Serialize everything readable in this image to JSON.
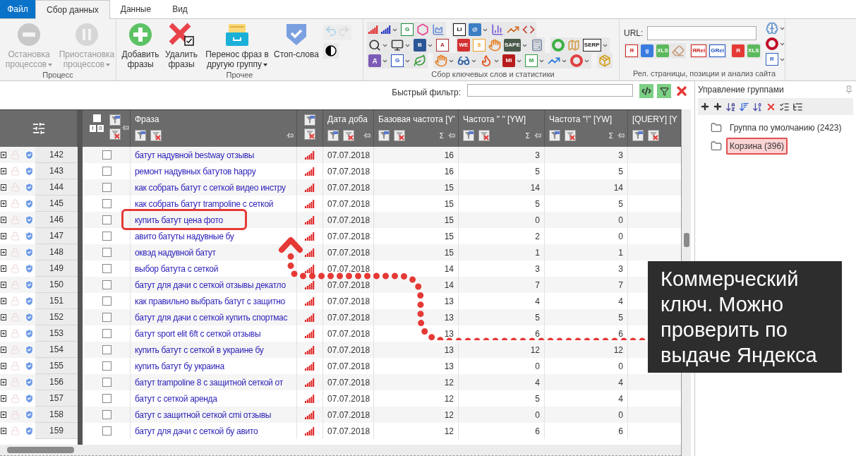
{
  "tabs": [
    {
      "label": "Файл",
      "kind": "file",
      "selected": false
    },
    {
      "label": "Сбор данных",
      "kind": "tab",
      "selected": true
    },
    {
      "label": "Данные",
      "kind": "tab",
      "selected": false
    },
    {
      "label": "Вид",
      "kind": "tab",
      "selected": false
    }
  ],
  "ribbon": {
    "process": {
      "label": "Процесс",
      "buttons": [
        {
          "kind": "stop",
          "label": "Остановка процессов",
          "disabled": true,
          "dropdown": true
        },
        {
          "kind": "pause",
          "label": "Приостановка процессов",
          "disabled": true,
          "dropdown": true
        }
      ]
    },
    "other": {
      "label": "Прочее",
      "buttons": [
        {
          "kind": "add",
          "label": "Добавить фразы",
          "disabled": false,
          "dropdown": false
        },
        {
          "kind": "delete",
          "label": "Удалить фразы",
          "disabled": false,
          "dropdown": false
        },
        {
          "kind": "move",
          "label": "Перенос фраз в другую группу",
          "disabled": false,
          "dropdown": true
        },
        {
          "kind": "stop_words",
          "label": "Стоп-слова",
          "disabled": false,
          "dropdown": false
        }
      ],
      "undo_disabled": true
    },
    "keywords": {
      "label": "Сбор ключевых слов и статистики",
      "rows": [
        [
          [
            {
              "kind": "bars",
              "color": "#e02020",
              "dropdown": false
            },
            {
              "kind": "bars",
              "color": "#2030c0",
              "dropdown": true
            },
            {
              "kind": "outline_letter",
              "text": "G",
              "color": "#1a8a3a",
              "dropdown": false
            },
            {
              "kind": "hexagon",
              "color": "#e84393",
              "dropdown": false
            },
            {
              "kind": "area",
              "color": "#6c8fd8",
              "dropdown": false
            }
          ],
          [
            {
              "kind": "outline_letter",
              "text": "Li",
              "color": "#111111",
              "dropdown": false
            },
            {
              "kind": "letter",
              "text": "@",
              "color": "#3c7dc4",
              "dropdown": true
            },
            {
              "kind": "column",
              "color": "#7b5bd6",
              "dropdown": false
            },
            {
              "kind": "trend",
              "color": "#d2691e",
              "dropdown": false
            },
            {
              "kind": "code",
              "color": "#c0392b",
              "dropdown": false
            }
          ]
        ],
        [
          [
            {
              "kind": "search",
              "color": "#333333",
              "dropdown": true
            },
            {
              "kind": "monitor",
              "color": "#444444",
              "dropdown": true
            },
            {
              "kind": "letter",
              "text": "B",
              "color": "#2b5797",
              "dropdown": true
            },
            {
              "kind": "outline_letter",
              "text": "A",
              "color": "#b03030",
              "dropdown": false
            }
          ],
          [
            {
              "kind": "letter",
              "text": "WE",
              "color": "#d32f2f",
              "dropdown": false
            },
            {
              "kind": "outline_letter",
              "text": "$",
              "color": "#f0a020",
              "dropdown": false
            },
            {
              "kind": "hand",
              "color": "#e67e22",
              "dropdown": false
            },
            {
              "kind": "letter",
              "text": "SAPE",
              "color": "#4a5a4a",
              "dropdown": true
            },
            {
              "kind": "calculator",
              "color": "#7a8aa0",
              "dropdown": false
            }
          ],
          [
            {
              "kind": "ring",
              "color": "#3cb043",
              "dropdown": false
            },
            {
              "kind": "map",
              "color": "#d4a050",
              "dropdown": false
            },
            {
              "kind": "outline_letter",
              "text": "SERP",
              "color": "#222222",
              "dropdown": true
            }
          ]
        ],
        [
          [
            {
              "kind": "letter",
              "text": "Д",
              "color": "#7b5bb6",
              "dropdown": true
            },
            {
              "kind": "outline_letter",
              "text": "G",
              "color": "#2050c0",
              "dropdown": true
            },
            {
              "kind": "leaf",
              "color": "#3a9a3a",
              "dropdown": false
            }
          ],
          [
            {
              "kind": "hand",
              "color": "#e67e22",
              "dropdown": true
            },
            {
              "kind": "glasses",
              "color": "#2c5fa8",
              "dropdown": true
            },
            {
              "kind": "flame",
              "color": "#e0501a",
              "dropdown": true
            },
            {
              "kind": "letter",
              "text": "MI",
              "color": "#b71c1c",
              "dropdown": true
            },
            {
              "kind": "outline_letter",
              "text": "M",
              "color": "#2e9a3e",
              "dropdown": true
            },
            {
              "kind": "trend",
              "color": "#2a7ad8",
              "dropdown": true
            },
            {
              "kind": "ring",
              "color": "#e04040",
              "dropdown": true
            }
          ],
          [
            {
              "kind": "package",
              "color": "#d4a020",
              "dropdown": false
            }
          ]
        ]
      ]
    },
    "site": {
      "label": "Рел. страницы, позиции и анализ сайта",
      "url_label": "URL:",
      "tools": [
        [
          {
            "kind": "outline_letter",
            "text": "Я",
            "color": "#d02020",
            "dropdown": false
          },
          {
            "kind": "letter",
            "text": "g",
            "color": "#3a7be0",
            "dropdown": false
          },
          {
            "kind": "letter",
            "text": "XLS",
            "color": "#5cb85c",
            "dropdown": false
          },
          {
            "kind": "eraser",
            "color": "#c8a080",
            "dropdown": false
          }
        ],
        [
          {
            "kind": "outline_letter",
            "text": "ЯRel",
            "color": "#d02020",
            "dropdown": false
          },
          {
            "kind": "outline_letter",
            "text": "GRel",
            "color": "#2050c0",
            "dropdown": false
          }
        ],
        [
          {
            "kind": "letter",
            "text": "Я",
            "color": "#e53935",
            "dropdown": false
          },
          {
            "kind": "letter",
            "text": "XLS",
            "color": "#5cb85c",
            "dropdown": false
          }
        ]
      ],
      "side_tools": [
        {
          "kind": "brain",
          "color": "#6a9ad0",
          "dropdown": true
        },
        {
          "kind": "ring",
          "color": "#c0102a",
          "dropdown": true
        },
        {
          "kind": "outline_letter",
          "text": "R",
          "color": "#3060c0",
          "dropdown": true
        }
      ]
    }
  },
  "quick_filter": {
    "label": "Быстрый фильтр:"
  },
  "table": {
    "select_all_checked": false,
    "check_buttons": [
      "I",
      "0"
    ],
    "columns": [
      {
        "label": "Фраза"
      },
      {
        "label": "Дата доба"
      },
      {
        "label": "Базовая частота [Y'",
        "sum": "Σ"
      },
      {
        "label": "Частота \" \" [YW]",
        "sum": "Σ"
      },
      {
        "label": "Частота \"!\" [YW]",
        "sum": "Σ"
      },
      {
        "label": "[QUERY] [Y"
      }
    ],
    "rows": [
      {
        "number": "142",
        "checked": false,
        "phrase": "батут надувной bestway отзывы",
        "date": "07.07.2018",
        "base": "16",
        "freq_quote": "3",
        "freq_excl": "3",
        "highlighted": false
      },
      {
        "number": "143",
        "checked": false,
        "phrase": "ремонт надувных батутов happy",
        "date": "07.07.2018",
        "base": "16",
        "freq_quote": "5",
        "freq_excl": "5",
        "highlighted": false
      },
      {
        "number": "144",
        "checked": false,
        "phrase": "как собрать батут с сеткой видео инстру",
        "date": "07.07.2018",
        "base": "15",
        "freq_quote": "14",
        "freq_excl": "14",
        "highlighted": false
      },
      {
        "number": "145",
        "checked": false,
        "phrase": "как собрать батут trampoline с сеткой",
        "date": "07.07.2018",
        "base": "15",
        "freq_quote": "5",
        "freq_excl": "5",
        "highlighted": false
      },
      {
        "number": "146",
        "checked": false,
        "phrase": "купить батут цена фото",
        "date": "07.07.2018",
        "base": "15",
        "freq_quote": "0",
        "freq_excl": "0",
        "highlighted": true
      },
      {
        "number": "147",
        "checked": false,
        "phrase": "авито батуты надувные бу",
        "date": "07.07.2018",
        "base": "15",
        "freq_quote": "2",
        "freq_excl": "0",
        "highlighted": false
      },
      {
        "number": "148",
        "checked": false,
        "phrase": "оквэд надувной батут",
        "date": "07.07.2018",
        "base": "15",
        "freq_quote": "1",
        "freq_excl": "1",
        "highlighted": false
      },
      {
        "number": "149",
        "checked": false,
        "phrase": "выбор батута с сеткой",
        "date": "07.07.2018",
        "base": "14",
        "freq_quote": "3",
        "freq_excl": "3",
        "highlighted": false
      },
      {
        "number": "150",
        "checked": false,
        "phrase": "батут для дачи с сеткой отзывы декатло",
        "date": "07.07.2018",
        "base": "14",
        "freq_quote": "7",
        "freq_excl": "7",
        "highlighted": false
      },
      {
        "number": "151",
        "checked": false,
        "phrase": "как правильно выбрать батут с защитно",
        "date": "07.07.2018",
        "base": "13",
        "freq_quote": "4",
        "freq_excl": "4",
        "highlighted": false
      },
      {
        "number": "152",
        "checked": false,
        "phrase": "батут для дачи с сеткой купить спортмас",
        "date": "07.07.2018",
        "base": "13",
        "freq_quote": "5",
        "freq_excl": "5",
        "highlighted": false
      },
      {
        "number": "153",
        "checked": false,
        "phrase": "батут sport elit 6ft с сеткой отзывы",
        "date": "07.07.2018",
        "base": "13",
        "freq_quote": "6",
        "freq_excl": "6",
        "highlighted": false
      },
      {
        "number": "154",
        "checked": false,
        "phrase": "купить батут с сеткой в украине бу",
        "date": "07.07.2018",
        "base": "13",
        "freq_quote": "12",
        "freq_excl": "12",
        "highlighted": false
      },
      {
        "number": "155",
        "checked": false,
        "phrase": "купить батут бу украина",
        "date": "07.07.2018",
        "base": "13",
        "freq_quote": "0",
        "freq_excl": "0",
        "highlighted": false
      },
      {
        "number": "156",
        "checked": false,
        "phrase": "батут trampoline 8 с защитной сеткой от",
        "date": "07.07.2018",
        "base": "12",
        "freq_quote": "4",
        "freq_excl": "4",
        "highlighted": false
      },
      {
        "number": "157",
        "checked": false,
        "phrase": "батут с сеткой аренда",
        "date": "07.07.2018",
        "base": "12",
        "freq_quote": "5",
        "freq_excl": "4",
        "highlighted": false
      },
      {
        "number": "158",
        "checked": false,
        "phrase": "батут с защитной сеткой cmi отзывы",
        "date": "07.07.2018",
        "base": "12",
        "freq_quote": "0",
        "freq_excl": "0",
        "highlighted": false
      },
      {
        "number": "159",
        "checked": false,
        "phrase": "батут для дачи с сеткой бу авито",
        "date": "07.07.2018",
        "base": "12",
        "freq_quote": "6",
        "freq_excl": "6",
        "highlighted": false
      }
    ]
  },
  "groups_panel": {
    "title": "Управление группами",
    "groups": [
      {
        "label": "Группа по умолчанию (2423)",
        "selected": false
      },
      {
        "label": "Корзина (396)",
        "selected": true
      }
    ]
  },
  "callout": {
    "text": "Коммерческий ключ. Можно проверить по выдаче Яндекса"
  }
}
